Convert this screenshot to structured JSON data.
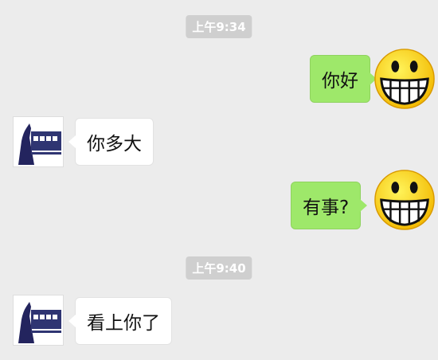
{
  "messages": [
    {
      "type": "time",
      "text": "上午9:34"
    },
    {
      "type": "outgoing",
      "text": "你好",
      "avatar": "grin-emoji-icon"
    },
    {
      "type": "incoming",
      "text": "你多大",
      "avatar": "logo-avatar"
    },
    {
      "type": "outgoing",
      "text": "有事?",
      "avatar": "grin-emoji-icon"
    },
    {
      "type": "time",
      "text": "上午9:40"
    },
    {
      "type": "incoming",
      "text": "看上你了",
      "avatar": "logo-avatar"
    }
  ],
  "colors": {
    "background": "#ececec",
    "outgoing_bubble": "#9ee86a",
    "incoming_bubble": "#ffffff",
    "timestamp_bg": "#cfcfcf"
  }
}
